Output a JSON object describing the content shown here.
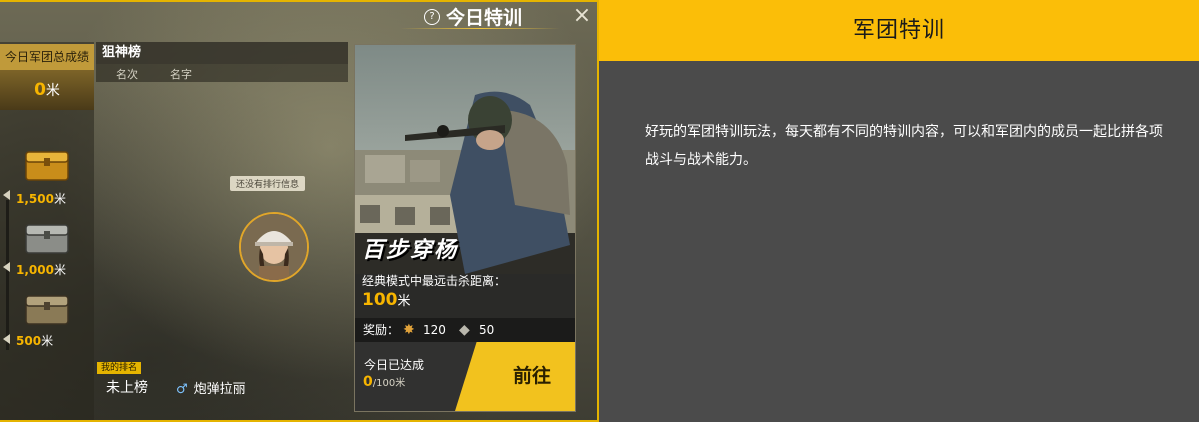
{
  "game": {
    "header": {
      "help_icon": "?",
      "title": "今日特训",
      "close_icon": "×"
    },
    "left_panel": {
      "total_label": "今日军团总成绩",
      "total_value": "0",
      "total_unit": "米",
      "rewards": [
        {
          "value": "1,500",
          "unit": "米",
          "icon": "gold-chest-icon"
        },
        {
          "value": "1,000",
          "unit": "米",
          "icon": "silver-chest-icon"
        },
        {
          "value": "500",
          "unit": "米",
          "icon": "bronze-chest-icon"
        }
      ]
    },
    "leaderboard": {
      "title": "狙神榜",
      "col_rank": "名次",
      "col_name": "名字",
      "empty_tip": "还没有排行信息",
      "my_rank_tag": "我的排名",
      "my_rank": "未上榜",
      "my_gender_icon": "♂",
      "my_name": "炮弹拉丽"
    },
    "challenge": {
      "name": "百步穿杨",
      "desc": "经典模式中最远击杀距离：",
      "target_value": "100",
      "target_unit": "米",
      "reward_label": "奖励：",
      "reward_items": [
        {
          "icon": "star-badge-icon",
          "value": "120"
        },
        {
          "icon": "crate-icon",
          "value": "50"
        }
      ],
      "done_label": "今日已达成",
      "done_value": "0",
      "done_total": "/100米",
      "go_button": "前往"
    }
  },
  "info": {
    "title": "军团特训",
    "body": "好玩的军团特训玩法，每天都有不同的特训内容，可以和军团内的成员一起比拼各项战斗与战术能力。"
  },
  "colors": {
    "accent": "#fbbe08",
    "panel_bg": "#4b4b4b",
    "gold_text": "#f7b500"
  }
}
